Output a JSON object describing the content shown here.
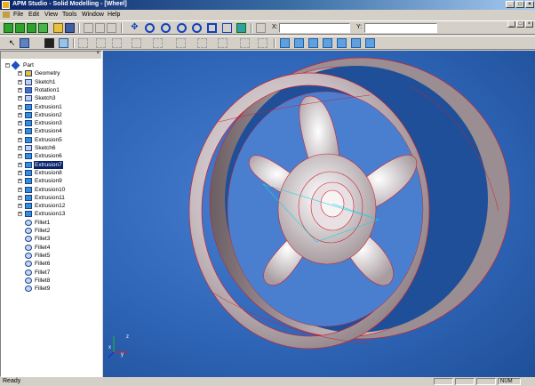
{
  "window": {
    "title": "APM Studio - Solid Modelling - [Wheel]"
  },
  "menu": [
    "File",
    "Edit",
    "View",
    "Tools",
    "Window",
    "Help"
  ],
  "coords": {
    "x_label": "X:",
    "y_label": "Y:",
    "x_value": "",
    "y_value": ""
  },
  "tree": {
    "root": "Part",
    "items": [
      "Geometry",
      "Sketch1",
      "Rotation1",
      "Sketch3",
      "Extrusion1",
      "Extrusion2",
      "Extrusion3",
      "Extrusion4",
      "Extrusion5",
      "Sketch6",
      "Extrusion6",
      "Extrusion7",
      "Extrusion8",
      "Extrusion9",
      "Extrusion10",
      "Extrusion11",
      "Extrusion12",
      "Extrusion13",
      "Fillet1",
      "Fillet2",
      "Fillet3",
      "Fillet4",
      "Fillet5",
      "Fillet6",
      "Fillet7",
      "Fillet8",
      "Fillet9"
    ],
    "selected_index": 11
  },
  "axes": {
    "x": "x",
    "y": "y",
    "z": "z"
  },
  "status": {
    "text": "Ready",
    "num": "NUM"
  },
  "colors": {
    "viewport_bg": "#2f66b8",
    "wheel_edge": "#d02030",
    "selection": "#0a246a"
  }
}
